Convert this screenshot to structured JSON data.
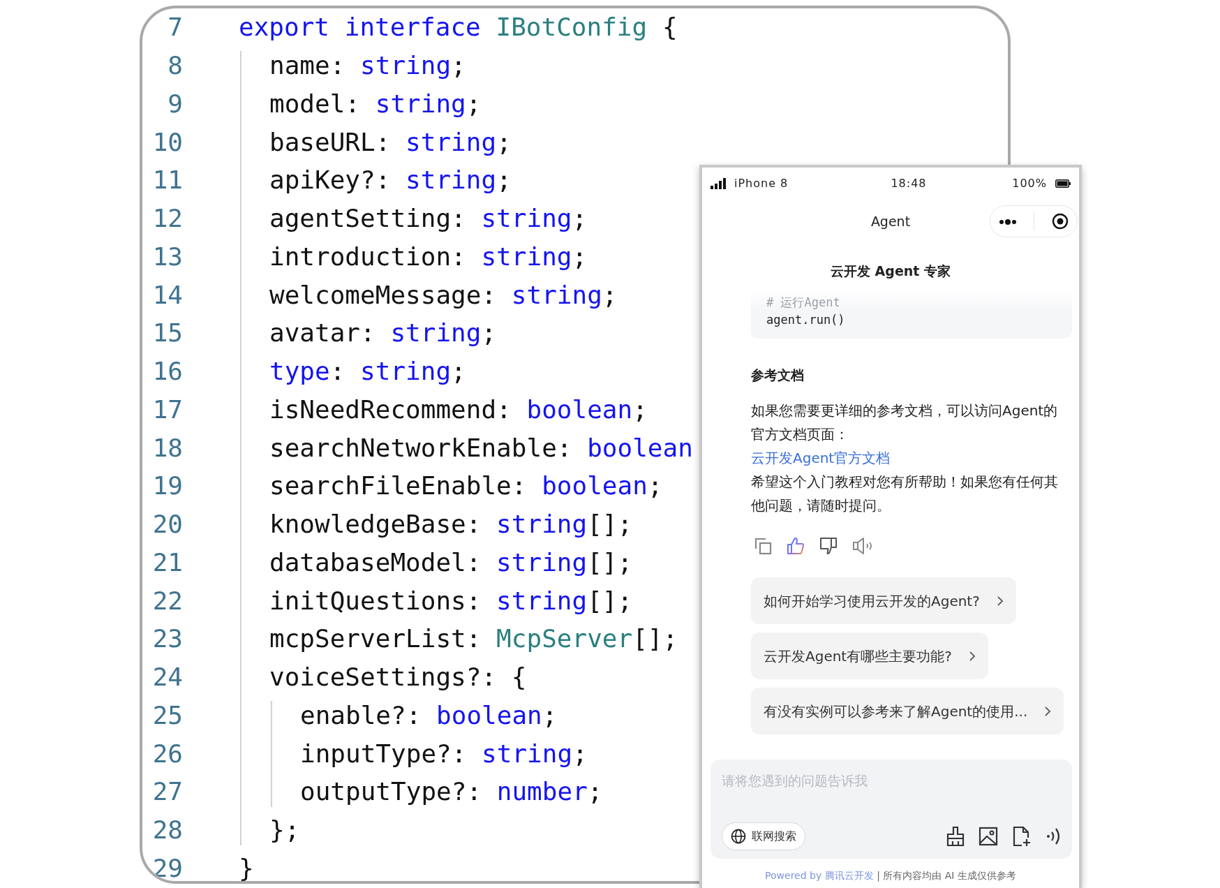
{
  "code_lines": [
    {
      "number": "7",
      "tokens": [
        {
          "kind": "keyword",
          "text": "export interface"
        },
        {
          "kind": "type",
          "text": " IBotConfig"
        },
        {
          "kind": "plain",
          "text": " {"
        }
      ],
      "children": [
        {
          "number": "8",
          "tokens": [
            {
              "kind": "plain",
              "text": "name: "
            },
            {
              "kind": "keyword",
              "text": "string"
            },
            {
              "kind": "plain",
              "text": ";"
            }
          ]
        },
        {
          "number": "9",
          "tokens": [
            {
              "kind": "plain",
              "text": "model: "
            },
            {
              "kind": "keyword",
              "text": "string"
            },
            {
              "kind": "plain",
              "text": ";"
            }
          ]
        },
        {
          "number": "10",
          "tokens": [
            {
              "kind": "plain",
              "text": "baseURL: "
            },
            {
              "kind": "keyword",
              "text": "string"
            },
            {
              "kind": "plain",
              "text": ";"
            }
          ]
        },
        {
          "number": "11",
          "tokens": [
            {
              "kind": "plain",
              "text": "apiKey?: "
            },
            {
              "kind": "keyword",
              "text": "string"
            },
            {
              "kind": "plain",
              "text": ";"
            }
          ]
        },
        {
          "number": "12",
          "tokens": [
            {
              "kind": "plain",
              "text": "agentSetting: "
            },
            {
              "kind": "keyword",
              "text": "string"
            },
            {
              "kind": "plain",
              "text": ";"
            }
          ]
        },
        {
          "number": "13",
          "tokens": [
            {
              "kind": "plain",
              "text": "introduction: "
            },
            {
              "kind": "keyword",
              "text": "string"
            },
            {
              "kind": "plain",
              "text": ";"
            }
          ]
        },
        {
          "number": "14",
          "tokens": [
            {
              "kind": "plain",
              "text": "welcomeMessage: "
            },
            {
              "kind": "keyword",
              "text": "string"
            },
            {
              "kind": "plain",
              "text": ";"
            }
          ]
        },
        {
          "number": "15",
          "tokens": [
            {
              "kind": "plain",
              "text": "avatar: "
            },
            {
              "kind": "keyword",
              "text": "string"
            },
            {
              "kind": "plain",
              "text": ";"
            }
          ]
        },
        {
          "number": "16",
          "tokens": [
            {
              "kind": "keyword",
              "text": "type"
            },
            {
              "kind": "plain",
              "text": ": "
            },
            {
              "kind": "keyword",
              "text": "string"
            },
            {
              "kind": "plain",
              "text": ";"
            }
          ]
        },
        {
          "number": "17",
          "tokens": [
            {
              "kind": "plain",
              "text": "isNeedRecommend: "
            },
            {
              "kind": "keyword",
              "text": "boolean"
            },
            {
              "kind": "plain",
              "text": ";"
            }
          ]
        },
        {
          "number": "18",
          "tokens": [
            {
              "kind": "plain",
              "text": "searchNetworkEnable: "
            },
            {
              "kind": "keyword",
              "text": "boolean"
            }
          ]
        },
        {
          "number": "19",
          "tokens": [
            {
              "kind": "plain",
              "text": "searchFileEnable: "
            },
            {
              "kind": "keyword",
              "text": "boolean"
            },
            {
              "kind": "plain",
              "text": ";"
            }
          ]
        },
        {
          "number": "20",
          "tokens": [
            {
              "kind": "plain",
              "text": "knowledgeBase: "
            },
            {
              "kind": "keyword",
              "text": "string"
            },
            {
              "kind": "plain",
              "text": "[];"
            }
          ]
        },
        {
          "number": "21",
          "tokens": [
            {
              "kind": "plain",
              "text": "databaseModel: "
            },
            {
              "kind": "keyword",
              "text": "string"
            },
            {
              "kind": "plain",
              "text": "[];"
            }
          ]
        },
        {
          "number": "22",
          "tokens": [
            {
              "kind": "plain",
              "text": "initQuestions: "
            },
            {
              "kind": "keyword",
              "text": "string"
            },
            {
              "kind": "plain",
              "text": "[];"
            }
          ]
        },
        {
          "number": "23",
          "tokens": [
            {
              "kind": "plain",
              "text": "mcpServerList: "
            },
            {
              "kind": "type",
              "text": "McpServer"
            },
            {
              "kind": "plain",
              "text": "[];"
            }
          ]
        },
        {
          "number": "24",
          "tokens": [
            {
              "kind": "plain",
              "text": "voiceSettings?: {"
            }
          ],
          "children": [
            {
              "number": "25",
              "tokens": [
                {
                  "kind": "plain",
                  "text": "enable?: "
                },
                {
                  "kind": "keyword",
                  "text": "boolean"
                },
                {
                  "kind": "plain",
                  "text": ";"
                }
              ]
            },
            {
              "number": "26",
              "tokens": [
                {
                  "kind": "plain",
                  "text": "inputType?: "
                },
                {
                  "kind": "keyword",
                  "text": "string"
                },
                {
                  "kind": "plain",
                  "text": ";"
                }
              ]
            },
            {
              "number": "27",
              "tokens": [
                {
                  "kind": "plain",
                  "text": "outputType?: "
                },
                {
                  "kind": "keyword",
                  "text": "number"
                },
                {
                  "kind": "plain",
                  "text": ";"
                }
              ]
            }
          ]
        },
        {
          "number": "28",
          "tokens": [
            {
              "kind": "plain",
              "text": "};"
            }
          ]
        }
      ]
    },
    {
      "number": "29",
      "tokens": [
        {
          "kind": "plain",
          "text": "}"
        }
      ]
    }
  ],
  "phone": {
    "status_bar": {
      "carrier": "iPhone 8",
      "time": "18:48",
      "battery": "100%"
    },
    "nav_title": "Agent",
    "chat_title": "云开发 Agent 专家",
    "code_snippet": [
      {
        "kind": "comment",
        "text": "# 运行Agent"
      },
      {
        "kind": "code",
        "text": "agent.run()"
      }
    ],
    "section_heading": "参考文档",
    "paragraphs": [
      {
        "kind": "text",
        "text": "如果您需要更详细的参考文档，可以访问Agent的官方文档页面："
      },
      {
        "kind": "link",
        "text": "云开发Agent官方文档"
      },
      {
        "kind": "text",
        "text": "希望这个入门教程对您有所帮助！如果您有任何其他问题，请随时提问。"
      }
    ],
    "suggestions": [
      "如何开始学习使用云开发的Agent?",
      "云开发Agent有哪些主要功能?",
      "有没有实例可以参考来了解Agent的使用..."
    ],
    "input": {
      "placeholder": "请将您遇到的问题告诉我",
      "search_chip": "联网搜索"
    },
    "footer": {
      "powered_by": "Powered by",
      "brand": "腾讯云开发",
      "separator": "|",
      "note": "所有内容均由 AI 生成仅供参考"
    }
  }
}
